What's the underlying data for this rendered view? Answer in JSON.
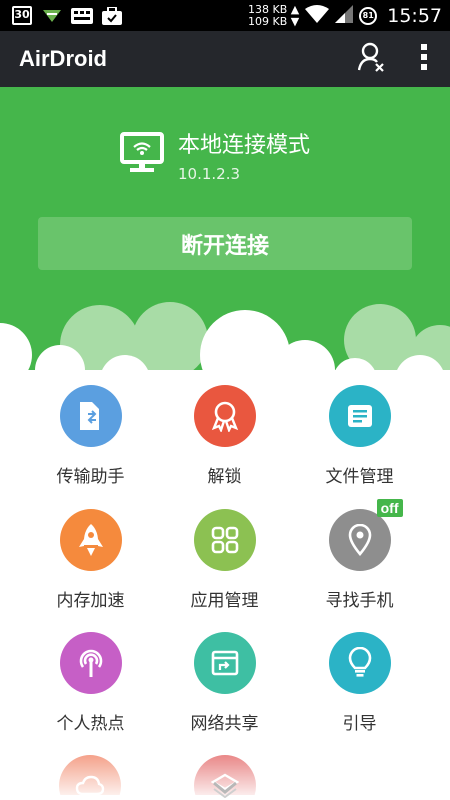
{
  "status_bar": {
    "calendar_day": "30",
    "net_up": "138 KB ▲",
    "net_down": "109 KB ▼",
    "battery": "81",
    "time": "15:57",
    "icons": [
      "calendar-icon",
      "download-icon",
      "keyboard-icon",
      "briefcase-icon",
      "wifi-icon",
      "signal-icon",
      "battery-icon"
    ]
  },
  "app_bar": {
    "title": "AirDroid",
    "actions": [
      "user-remove-icon",
      "overflow-menu-icon"
    ]
  },
  "connection": {
    "mode": "本地连接模式",
    "ip": "10.1.2.3",
    "disconnect_label": "断开连接"
  },
  "grid": [
    {
      "label": "传输助手",
      "color": "#5b9fe0",
      "icon": "file-transfer-icon"
    },
    {
      "label": "解锁",
      "color": "#e9573f",
      "icon": "unlock-badge-icon"
    },
    {
      "label": "文件管理",
      "color": "#2bb3c6",
      "icon": "file-manager-icon"
    },
    {
      "label": "内存加速",
      "color": "#f58a3d",
      "icon": "rocket-icon"
    },
    {
      "label": "应用管理",
      "color": "#8cc152",
      "icon": "apps-grid-icon"
    },
    {
      "label": "寻找手机",
      "color": "#8e8e8e",
      "icon": "location-pin-icon",
      "badge": "off"
    },
    {
      "label": "个人热点",
      "color": "#c65fc6",
      "icon": "hotspot-icon"
    },
    {
      "label": "网络共享",
      "color": "#3ebfa3",
      "icon": "network-share-icon"
    },
    {
      "label": "引导",
      "color": "#2bb3c6",
      "icon": "lightbulb-icon"
    }
  ],
  "partial_items": [
    {
      "color": "#f07a5a",
      "icon": "cloud-icon"
    },
    {
      "color": "#e05555",
      "icon": "stack-icon"
    }
  ],
  "colors": {
    "primary_green": "#45b64b",
    "app_bar": "#25272c",
    "button_green": "#69c46b"
  }
}
